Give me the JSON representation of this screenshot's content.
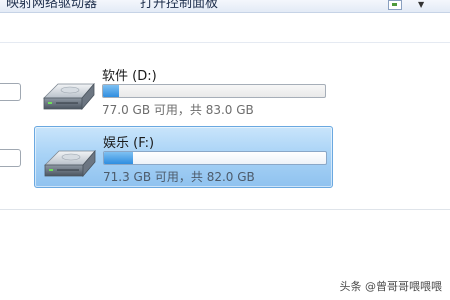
{
  "toolbar": {
    "map_network_drive_label": "映射网络驱动器",
    "open_control_panel_label": "打开控制面板",
    "view_icon": "view-options-icon",
    "dropdown_icon": "chevron-down-icon"
  },
  "drives": [
    {
      "name": "软件 (D:)",
      "free_text": "77.0 GB 可用，共 83.0 GB",
      "used_fraction": 0.072,
      "selected": false,
      "icon": "hard-drive-icon"
    },
    {
      "name": "娱乐 (F:)",
      "free_text": "71.3 GB 可用，共 82.0 GB",
      "used_fraction": 0.13,
      "selected": true,
      "icon": "hard-drive-icon"
    }
  ],
  "watermark": "头条 @曾哥哥喂喂喂",
  "colors": {
    "selection_fill": "#a9d3f6",
    "selection_border": "#6aa8e0",
    "capacity_fill": "#2f8ee0"
  }
}
